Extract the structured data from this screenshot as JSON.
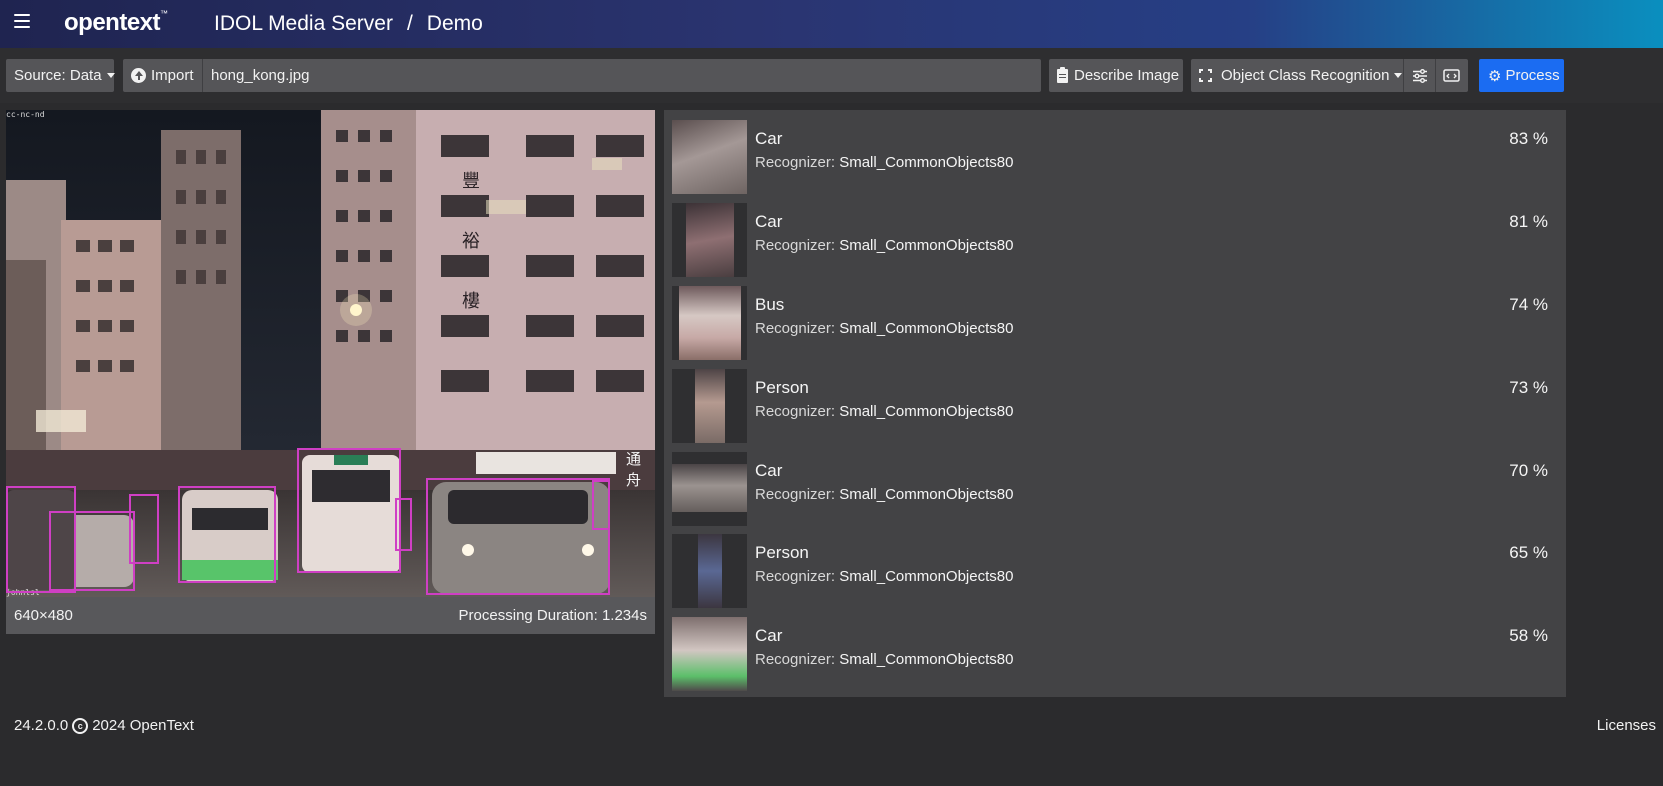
{
  "header": {
    "brand": "opentext",
    "brand_tm": "™",
    "app_name": "IDOL Media Server",
    "separator": "/",
    "page_name": "Demo"
  },
  "toolbar": {
    "source_label": "Source: Data",
    "import_label": "Import",
    "file_name": "hong_kong.jpg",
    "describe_label": "Describe Image",
    "analysis_label": "Object Class Recognition",
    "process_label": "Process"
  },
  "image": {
    "watermark_top": "cc-nc-nd",
    "watermark_bottom": "johnlsl",
    "signs": [
      "豐",
      "裕",
      "樓"
    ],
    "side_sign": "通舟",
    "dimensions": "640×480",
    "duration_label": "Processing Duration:",
    "duration_value": "1.234s"
  },
  "results": [
    {
      "label": "Car",
      "recognizer_label": "Recognizer:",
      "recognizer": "Small_CommonObjects80",
      "confidence": "83 %"
    },
    {
      "label": "Car",
      "recognizer_label": "Recognizer:",
      "recognizer": "Small_CommonObjects80",
      "confidence": "81 %"
    },
    {
      "label": "Bus",
      "recognizer_label": "Recognizer:",
      "recognizer": "Small_CommonObjects80",
      "confidence": "74 %"
    },
    {
      "label": "Person",
      "recognizer_label": "Recognizer:",
      "recognizer": "Small_CommonObjects80",
      "confidence": "73 %"
    },
    {
      "label": "Car",
      "recognizer_label": "Recognizer:",
      "recognizer": "Small_CommonObjects80",
      "confidence": "70 %"
    },
    {
      "label": "Person",
      "recognizer_label": "Recognizer:",
      "recognizer": "Small_CommonObjects80",
      "confidence": "65 %"
    },
    {
      "label": "Car",
      "recognizer_label": "Recognizer:",
      "recognizer": "Small_CommonObjects80",
      "confidence": "58 %"
    }
  ],
  "footer": {
    "version": "24.2.0.0",
    "copyright": "2024 OpenText",
    "licenses": "Licenses"
  },
  "colors": {
    "accent": "#1b6cf2",
    "bbox": "#cf3fc4"
  }
}
